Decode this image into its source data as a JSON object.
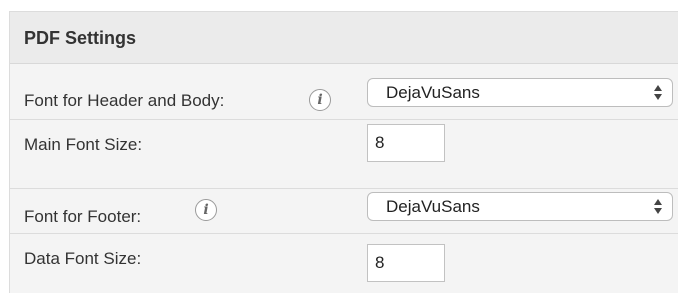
{
  "panel": {
    "title": "PDF Settings"
  },
  "rows": [
    {
      "label": "Font for Header and Body:",
      "has_info_icon": true,
      "info_icon": "info-icon",
      "control": "select",
      "value": "DejaVuSans"
    },
    {
      "label": "Main Font Size:",
      "has_info_icon": false,
      "control": "text-input",
      "value": "8"
    },
    {
      "label": "Font for Footer:",
      "has_info_icon": true,
      "info_icon": "info-icon",
      "control": "select",
      "value": "DejaVuSans"
    },
    {
      "label": "Data Font Size:",
      "has_info_icon": false,
      "control": "text-input",
      "value": "8"
    }
  ],
  "icons": {
    "info_glyph": "i",
    "select_arrows": "up-down-arrows-icon"
  },
  "colors": {
    "panel_background": "#f4f4f4",
    "header_background": "#ebebeb",
    "border": "#dcdcdc"
  }
}
